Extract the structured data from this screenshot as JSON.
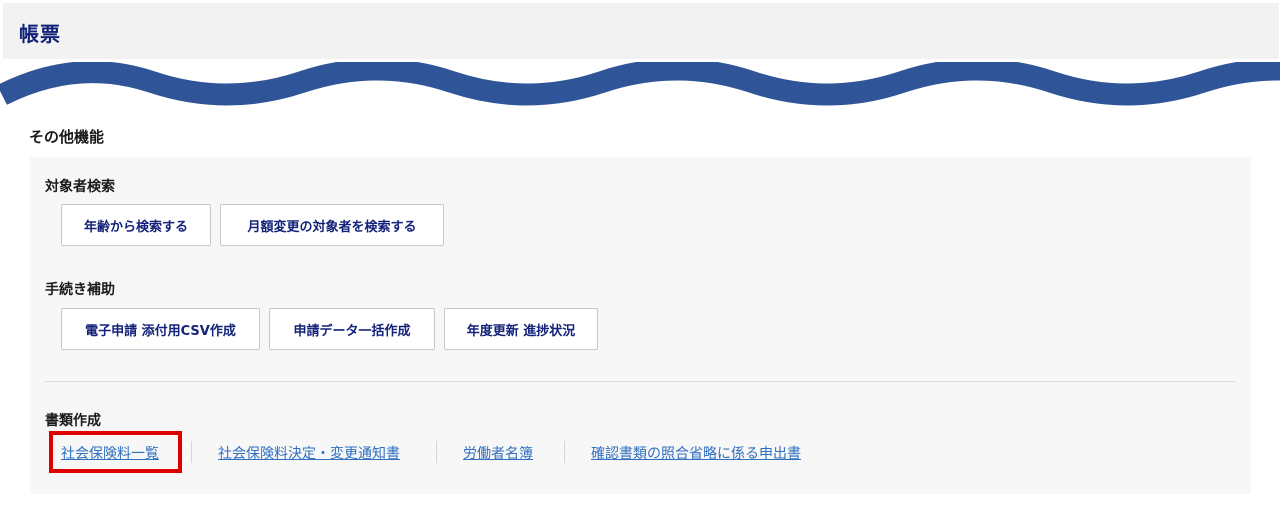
{
  "header": {
    "title": "帳票"
  },
  "section": {
    "title": "その他機能"
  },
  "groups": {
    "search": {
      "label": "対象者検索",
      "buttons": [
        "年齢から検索する",
        "月額変更の対象者を検索する"
      ]
    },
    "assist": {
      "label": "手続き補助",
      "buttons": [
        "電子申請 添付用CSV作成",
        "申請データ一括作成",
        "年度更新 進捗状況"
      ]
    },
    "documents": {
      "label": "書類作成",
      "links": [
        "社会保険料一覧",
        "社会保険料決定・変更通知書",
        "労働者名簿",
        "確認書類の照合省略に係る申出書"
      ]
    }
  },
  "colors": {
    "title": "#14237a",
    "wave": "#2f5598",
    "link": "#2f6fc0",
    "highlight": "#e00000",
    "panel": "#f7f7f7"
  }
}
